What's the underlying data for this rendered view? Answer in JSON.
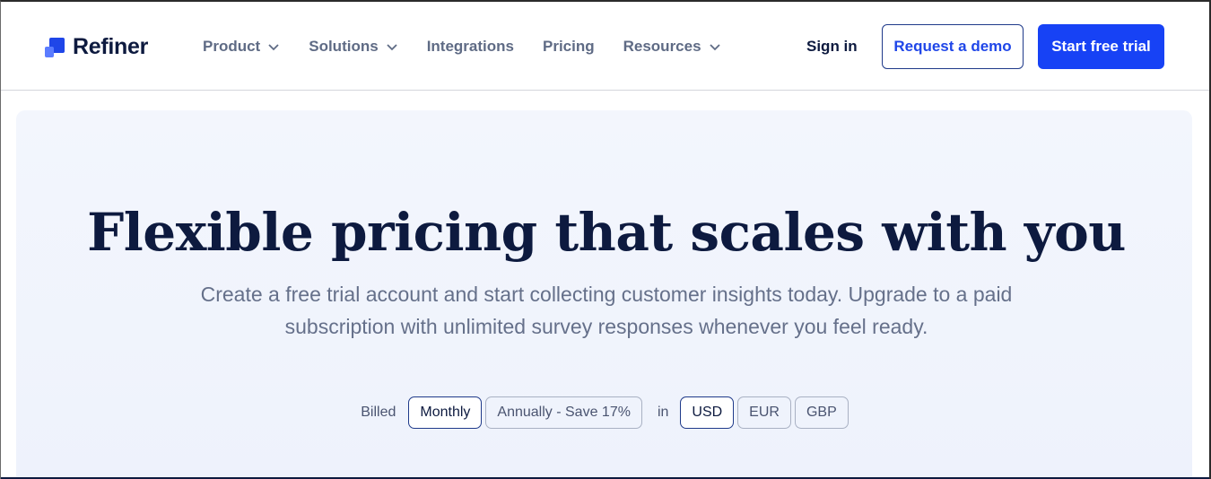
{
  "nav": {
    "brand": "Refiner",
    "menu": [
      {
        "label": "Product",
        "has_dropdown": true
      },
      {
        "label": "Solutions",
        "has_dropdown": true
      },
      {
        "label": "Integrations",
        "has_dropdown": false
      },
      {
        "label": "Pricing",
        "has_dropdown": false
      },
      {
        "label": "Resources",
        "has_dropdown": true
      }
    ],
    "sign_in": "Sign in",
    "demo_button": "Request a demo",
    "trial_button": "Start free trial"
  },
  "hero": {
    "title": "Flexible pricing that scales with you",
    "subtitle_line1": "Create a free trial account and start collecting customer insights today. Upgrade to a paid",
    "subtitle_line2": "subscription with unlimited survey responses whenever you feel ready."
  },
  "billing": {
    "billed_label": "Billed",
    "periods": [
      {
        "label": "Monthly",
        "selected": true
      },
      {
        "label": "Annually - Save 17%",
        "selected": false
      }
    ],
    "in_label": "in",
    "currencies": [
      {
        "label": "USD",
        "selected": true
      },
      {
        "label": "EUR",
        "selected": false
      },
      {
        "label": "GBP",
        "selected": false
      }
    ]
  },
  "colors": {
    "brand_blue": "#1742f5",
    "navy": "#0d1a3f",
    "muted_text": "#65708a",
    "hero_bg": "#f3f6fd"
  }
}
